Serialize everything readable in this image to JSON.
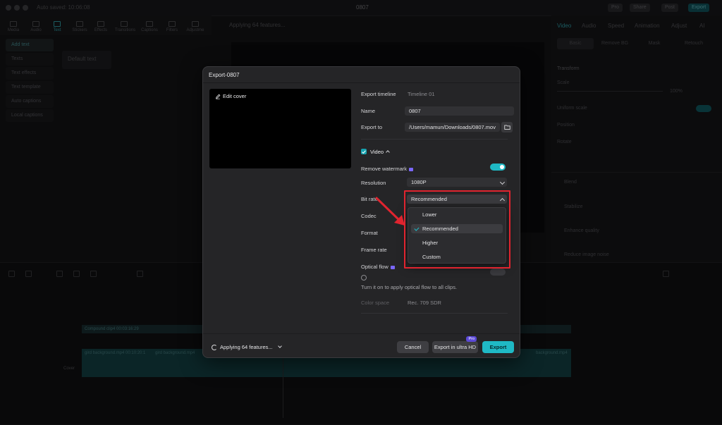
{
  "app": {
    "autosave_text": "Auto saved: 10:06:08",
    "project_name": "0807",
    "top_buttons": [
      "Pro",
      "Share",
      "Post",
      "Export"
    ],
    "tools": [
      "Media",
      "Audio",
      "Text",
      "Stickers",
      "Effects",
      "Transitions",
      "Captions",
      "Filters",
      "Adjustme"
    ],
    "left_nav": [
      "Add text",
      "Texts",
      "Text effects",
      "Text template",
      "Auto captions",
      "Local captions"
    ],
    "default_text": "Default text",
    "preview_status": "Applying 64 features...",
    "right_tabs": [
      "Video",
      "Audio",
      "Speed",
      "Animation",
      "Adjust",
      "AI"
    ],
    "right_subtabs": [
      "Basic",
      "Remove BG",
      "Mask",
      "Retouch"
    ],
    "right_labels": {
      "transform": "Transform",
      "scale": "Scale",
      "scale_value": "100%",
      "uniform_scale": "Uniform scale",
      "position": "Position",
      "rotate": "Rotate",
      "blend": "Blend",
      "stabilize": "Stabilize",
      "enhance_quality": "Enhance quality",
      "reduce_noise": "Reduce image noise"
    },
    "timeline": {
      "compound_clip": "Compound clip4  00:03:16:29",
      "clip1": "gird background.mp4  00:10:20:1",
      "clip2": "gird background.mp4",
      "clip3": "background.mp4",
      "cover_label": "Cover"
    }
  },
  "dialog": {
    "title": "Export-0807",
    "edit_cover": "Edit cover",
    "export_timeline_label": "Export timeline",
    "export_timeline_value": "Timeline 01",
    "name_label": "Name",
    "name_value": "0807",
    "export_to_label": "Export to",
    "export_to_value": "/Users/mamun/Downloads/0807.mov",
    "video_section": "Video",
    "remove_watermark_label": "Remove watermark",
    "resolution_label": "Resolution",
    "resolution_value": "1080P",
    "bitrate_label": "Bit rate",
    "bitrate_value": "Recommended",
    "codec_label": "Codec",
    "format_label": "Format",
    "framerate_label": "Frame rate",
    "optical_flow_label": "Optical flow",
    "optical_flow_hint": "Turn it on to apply optical flow to all clips.",
    "color_space_label": "Color space",
    "color_space_value": "Rec. 709 SDR",
    "bitrate_options": [
      "Lower",
      "Recommended",
      "Higher",
      "Custom"
    ],
    "footer_status": "Applying 64 features...",
    "cancel": "Cancel",
    "ultra_hd": "Export in ultra HD",
    "ultra_badge": "Pro",
    "export": "Export"
  },
  "colors": {
    "accent": "#1fb9c5",
    "highlight": "#e0242f",
    "dialog_bg": "#252527"
  }
}
